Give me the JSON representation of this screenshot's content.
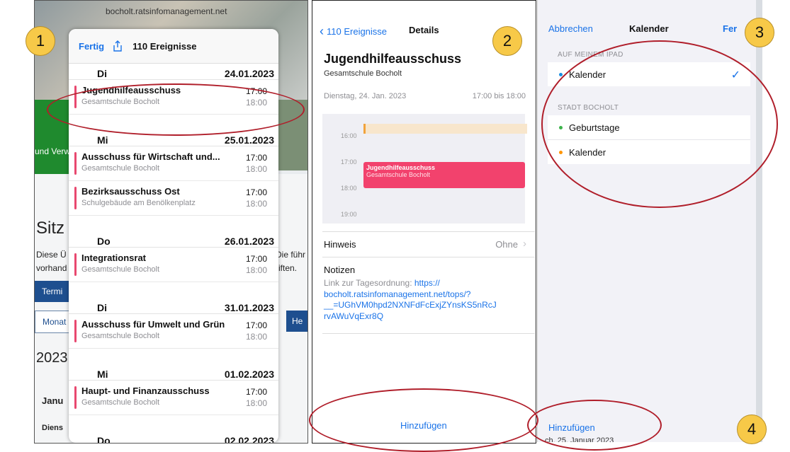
{
  "badges": [
    "1",
    "2",
    "3",
    "4"
  ],
  "panel1": {
    "url": "bocholt.ratsinfomanagement.net",
    "bg_texts": {
      "und_verw": "und Verw",
      "sitz": "Sitz",
      "diese": "Diese Ü",
      "vorhand": "vorhand",
      "die_fuehr": "Die führ",
      "riften": "riften.",
      "termin": "Termi",
      "monat": "Monat",
      "he": "He",
      "year": "2023",
      "janu": "Janu",
      "diens": "Diens"
    },
    "header": {
      "done": "Fertig",
      "title": "110 Ereignisse"
    },
    "groups": [
      {
        "day": "Di",
        "date": "24.01.2023",
        "events": [
          {
            "title": "Jugendhilfeausschuss",
            "place": "Gesamtschule Bocholt",
            "start": "17:00",
            "end": "18:00"
          }
        ]
      },
      {
        "day": "Mi",
        "date": "25.01.2023",
        "events": [
          {
            "title": "Ausschuss für Wirtschaft und...",
            "place": "Gesamtschule Bocholt",
            "start": "17:00",
            "end": "18:00"
          },
          {
            "title": "Bezirksausschuss Ost",
            "place": "Schulgebäude am Benölkenplatz",
            "start": "17:00",
            "end": "18:00"
          }
        ]
      },
      {
        "day": "Do",
        "date": "26.01.2023",
        "events": [
          {
            "title": "Integrationsrat",
            "place": "Gesamtschule Bocholt",
            "start": "17:00",
            "end": "18:00"
          }
        ]
      },
      {
        "day": "Di",
        "date": "31.01.2023",
        "events": [
          {
            "title": "Ausschuss für Umwelt und Grün",
            "place": "Gesamtschule Bocholt",
            "start": "17:00",
            "end": "18:00"
          }
        ]
      },
      {
        "day": "Mi",
        "date": "01.02.2023",
        "events": [
          {
            "title": "Haupt- und Finanzausschuss",
            "place": "Gesamtschule Bocholt",
            "start": "17:00",
            "end": "18:00"
          }
        ]
      },
      {
        "day": "Do",
        "date": "02.02.2023",
        "events": []
      }
    ]
  },
  "panel2": {
    "back": "110 Ereignisse",
    "nav_title": "Details",
    "title": "Jugendhilfeausschuss",
    "place": "Gesamtschule Bocholt",
    "date": "Dienstag, 24. Jan. 2023",
    "time": "17:00 bis 18:00",
    "hours": [
      "16:00",
      "17:00",
      "18:00",
      "19:00"
    ],
    "block_title": "Jugendhilfeausschuss",
    "block_place": "Gesamtschule Bocholt",
    "alert_label": "Hinweis",
    "alert_value": "Ohne",
    "notes_label": "Notizen",
    "notes_prefix": "Link zur Tagesordnung: ",
    "notes_link_1": "https://",
    "notes_link_2": "bocholt.ratsinfomanagement.net/tops/?",
    "notes_link_3": "__=UGhVM0hpd2NXNFdFcExjZYnsKS5nRcJ",
    "notes_link_4": "rvAWuVqExr8Q",
    "add_button": "Hinzufügen"
  },
  "panel3": {
    "cancel": "Abbrechen",
    "title": "Kalender",
    "done": "Fer",
    "section1": "AUF MEINEM IPAD",
    "section2": "STADT BOCHOLT",
    "calendars_ipad": [
      {
        "name": "Kalender",
        "color": "#1a8fe3",
        "checked": true
      }
    ],
    "calendars_bocholt": [
      {
        "name": "Geburtstage",
        "color": "#3cb34a"
      },
      {
        "name": "Kalender",
        "color": "#ff9500"
      }
    ],
    "add_button": "Hinzufügen",
    "footer": "ch, 25. Januar 2023"
  }
}
